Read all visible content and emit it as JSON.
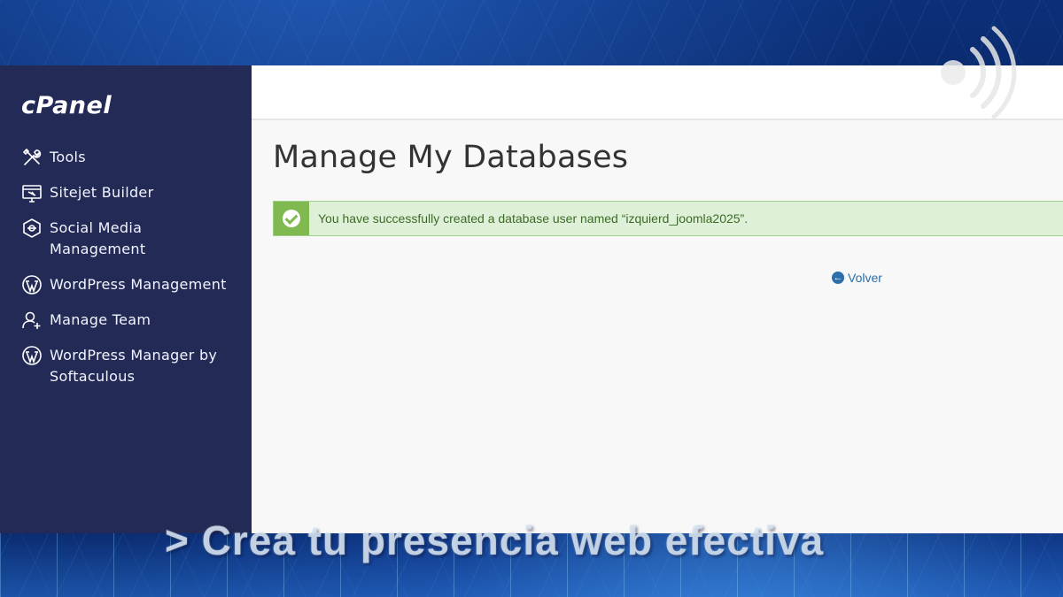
{
  "brand": {
    "logo_text": "cPanel"
  },
  "sidebar": {
    "items": [
      {
        "label": "Tools",
        "icon": "tools-icon"
      },
      {
        "label": "Sitejet Builder",
        "icon": "sitejet-icon"
      },
      {
        "label": "Social Media Management",
        "icon": "social-media-icon"
      },
      {
        "label": "WordPress Management",
        "icon": "wordpress-icon"
      },
      {
        "label": "Manage Team",
        "icon": "manage-team-icon"
      },
      {
        "label": "WordPress Manager by Softaculous",
        "icon": "wordpress-icon"
      }
    ]
  },
  "main": {
    "title": "Manage My Databases",
    "alert": {
      "type": "success",
      "icon": "check-circle-icon",
      "text": "You have successfully created a database user named “izquierd_joomla2025”."
    },
    "back_link": {
      "label": "Volver",
      "icon": "arrow-left-circle-icon"
    }
  },
  "overlay": {
    "caption": "> Crea tu presencia web efectiva"
  },
  "colors": {
    "sidebar_bg": "#222a55",
    "success_bg": "#dff0d8",
    "success_icon_bg": "#80b94f",
    "link": "#2c6eaa"
  }
}
